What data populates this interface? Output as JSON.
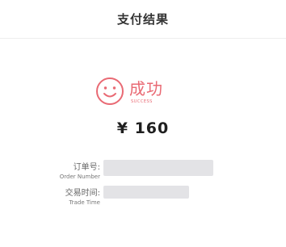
{
  "header": {
    "title": "支付结果"
  },
  "result": {
    "icon": "smile-icon",
    "status": "成功",
    "status_en": "SUCCESS",
    "accent_color": "#e96a74"
  },
  "payment": {
    "amount": "¥ 160"
  },
  "details": {
    "order": {
      "label_cn": "订单号:",
      "label_en": "Order Number",
      "value": ""
    },
    "time": {
      "label_cn": "交易时间:",
      "label_en": "Trade Time",
      "value": ""
    }
  }
}
